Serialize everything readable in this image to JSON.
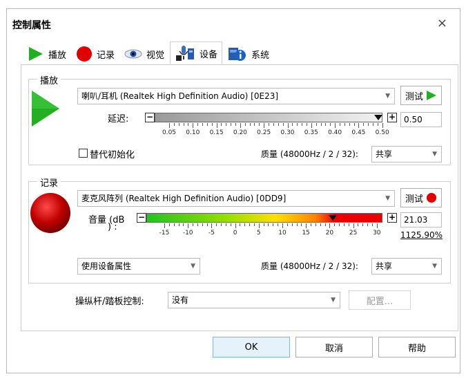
{
  "dialog": {
    "title": "控制属性",
    "close_glyph": "×"
  },
  "tabs": [
    {
      "label": "播放",
      "icon": "play-icon"
    },
    {
      "label": "记录",
      "icon": "record-icon"
    },
    {
      "label": "视觉",
      "icon": "eye-icon"
    },
    {
      "label": "设备",
      "icon": "device-icon",
      "active": true
    },
    {
      "label": "系统",
      "icon": "system-info-icon"
    }
  ],
  "playback": {
    "group_title": "播放",
    "device": "喇叭/耳机 (Realtek High Definition Audio) [0E23]",
    "test_label": "测试",
    "delay_label": "延迟:",
    "delay_value": "0.50",
    "delay_ticks": [
      "0.05",
      "0.10",
      "0.15",
      "0.20",
      "0.25",
      "0.30",
      "0.35",
      "0.40",
      "0.45",
      "0.50"
    ],
    "delay_level": 1.0,
    "alt_init_label": "替代初始化",
    "quality_label": "质量 (48000Hz / 2 / 32):",
    "share_value": "共享",
    "minus": "−",
    "plus": "+"
  },
  "record": {
    "group_title": "记录",
    "device": "麦克风阵列 (Realtek High Definition Audio) [0DD9]",
    "test_label": "测试",
    "volume_label_1": "音量 (dB",
    "volume_label_2": ") :",
    "volume_value": "21.03",
    "volume_percent": "1125.90%",
    "volume_ticks": [
      "-15",
      "-10",
      "-5",
      "0",
      "5",
      "10",
      "15",
      "20",
      "25",
      "30"
    ],
    "device_props": "使用设备属性",
    "quality_label": "质量 (48000Hz / 2 / 32):",
    "share_value": "共享",
    "minus": "−",
    "plus": "+"
  },
  "joystick": {
    "label": "操纵杆/踏板控制:",
    "value": "没有",
    "config_label": "配置..."
  },
  "footer": {
    "ok": "OK",
    "cancel": "取消",
    "help": "帮助"
  },
  "colors": {
    "play_green": "#22b022",
    "record_red": "#d40000",
    "accent": "#7eb4ea"
  }
}
